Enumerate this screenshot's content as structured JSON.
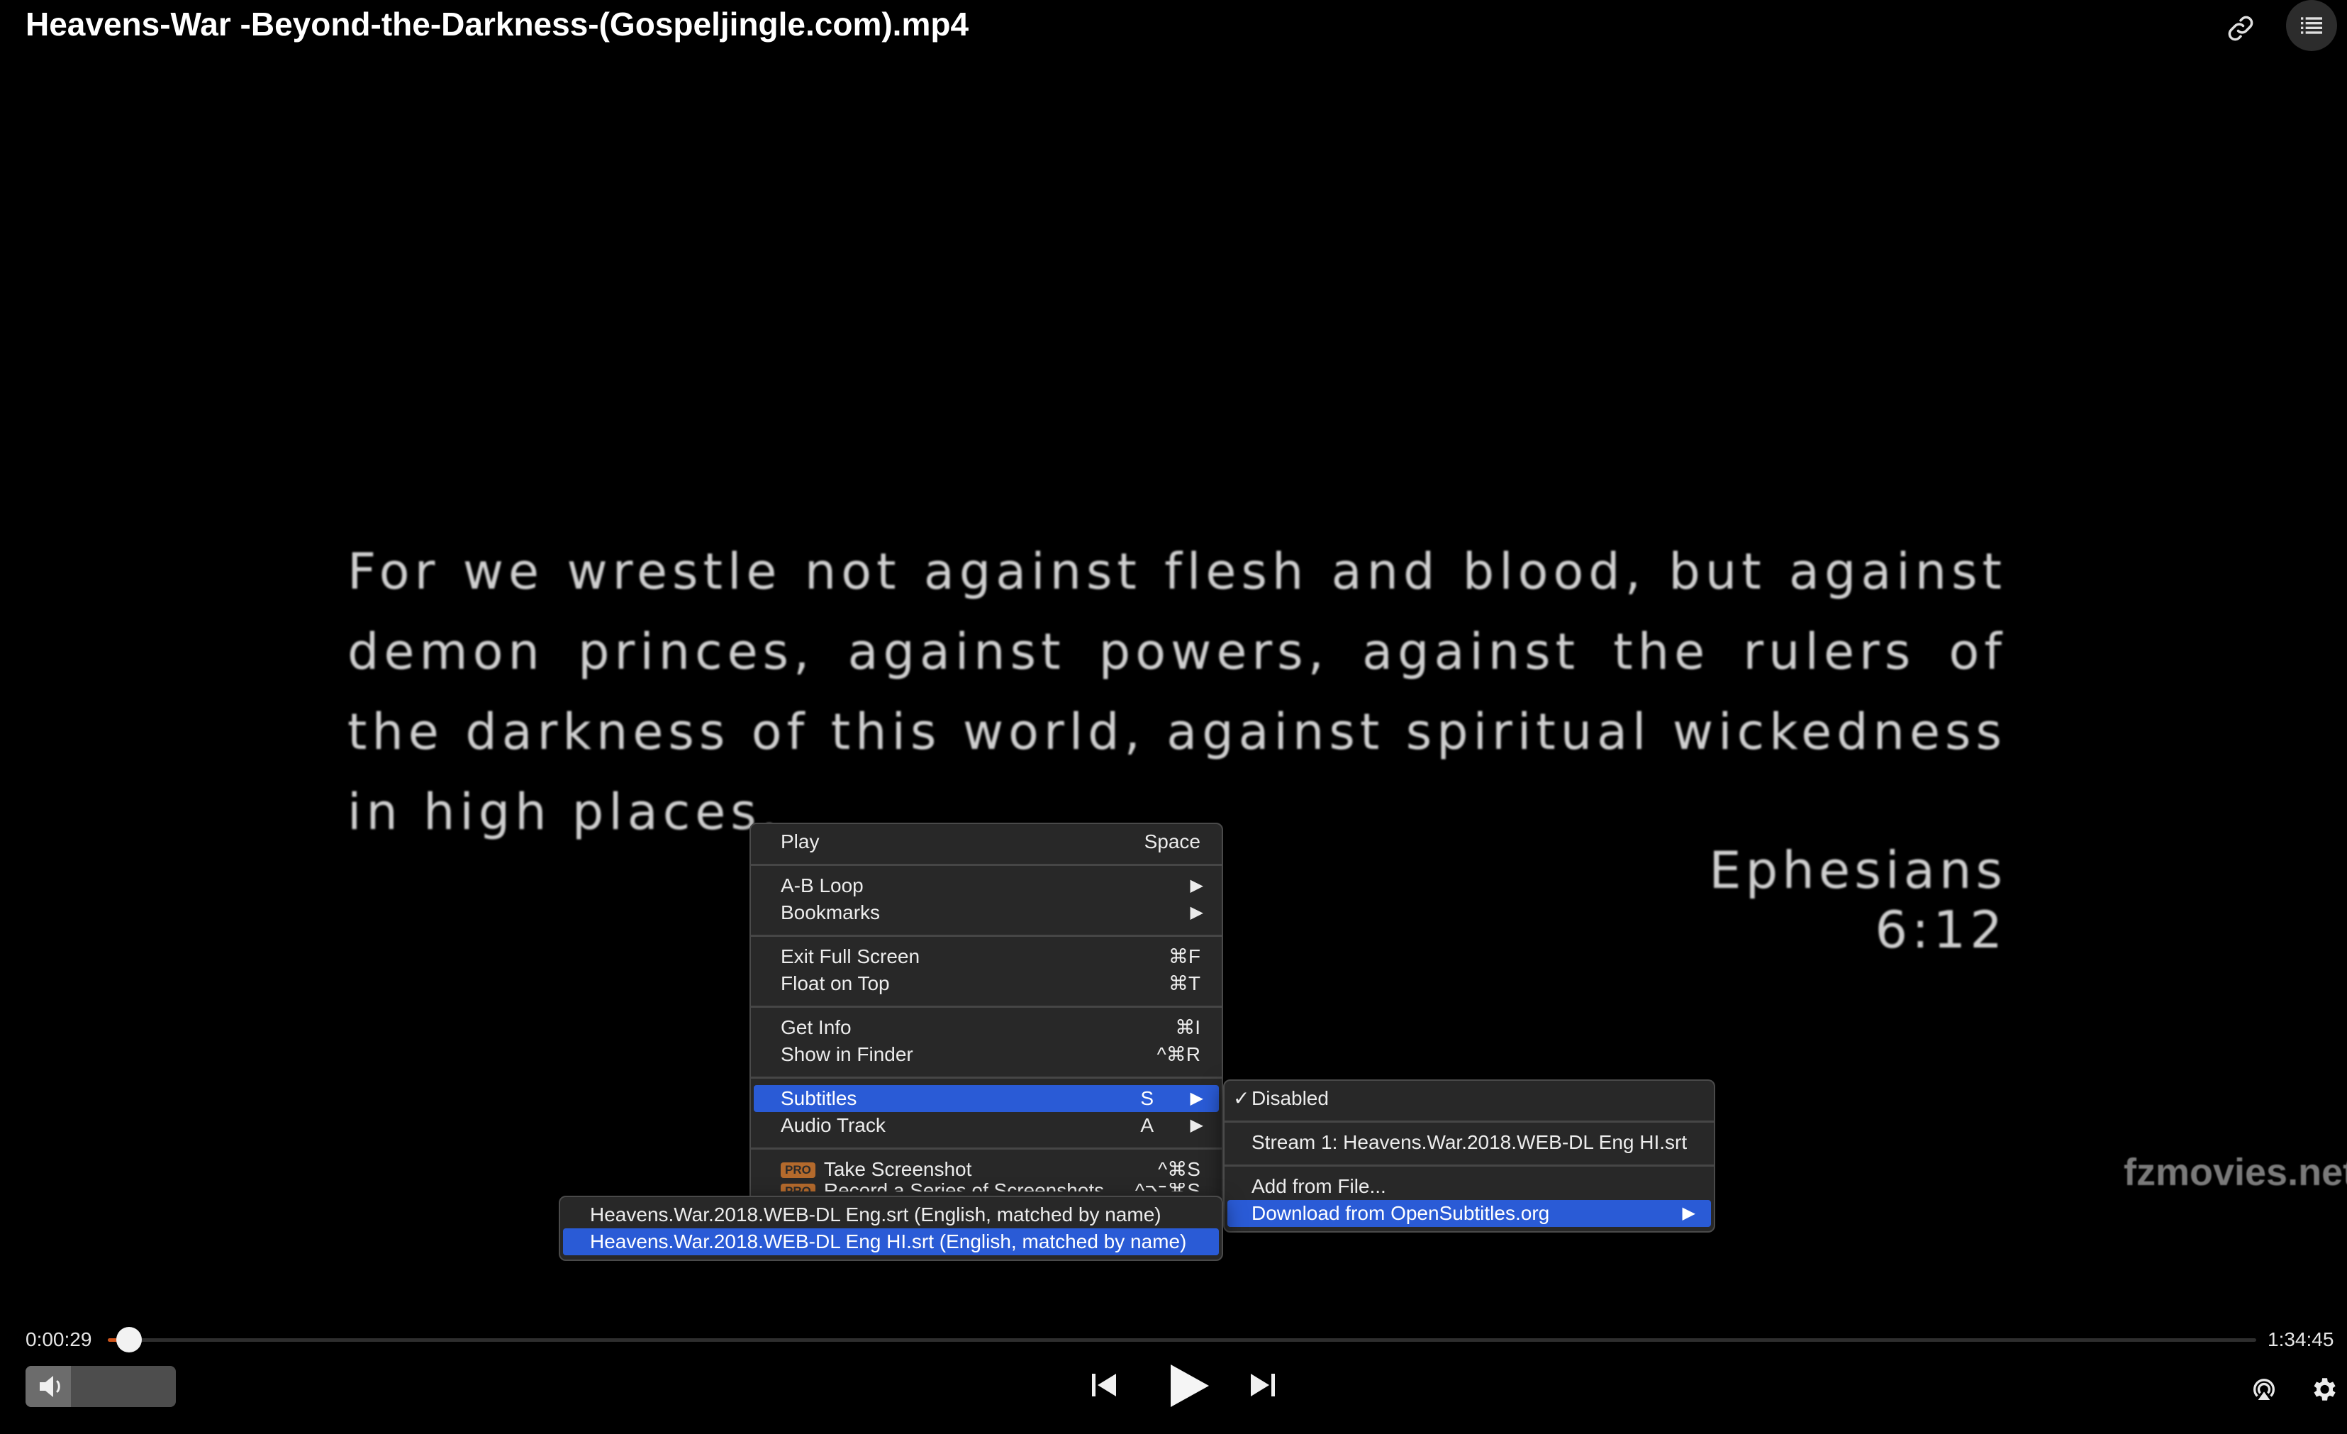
{
  "window": {
    "title": "Heavens-War -Beyond-the-Darkness-(Gospeljingle.com).mp4"
  },
  "video": {
    "verse_text": "For we wrestle not against flesh and blood, but against demon princes, against powers, against the rulers of the darkness of this world, against spiritual wickedness in high places.",
    "reference": "Ephesians 6:12",
    "watermark": "fzmovies.net"
  },
  "context_menu": {
    "play": {
      "label": "Play",
      "shortcut": "Space"
    },
    "ab_loop": {
      "label": "A-B Loop",
      "arrow": "▶"
    },
    "bookmarks": {
      "label": "Bookmarks",
      "arrow": "▶"
    },
    "exit_full_screen": {
      "label": "Exit Full Screen",
      "shortcut": "⌘F"
    },
    "float_on_top": {
      "label": "Float on Top",
      "shortcut": "⌘T"
    },
    "get_info": {
      "label": "Get Info",
      "shortcut": "⌘I"
    },
    "show_in_finder": {
      "label": "Show in Finder",
      "shortcut": "^⌘R"
    },
    "subtitles": {
      "label": "Subtitles",
      "key": "S",
      "arrow": "▶"
    },
    "audio_track": {
      "label": "Audio Track",
      "key": "A",
      "arrow": "▶"
    },
    "take_screenshot": {
      "badge": "PRO",
      "label": "Take Screenshot",
      "shortcut": "^⌘S"
    },
    "record_screenshots": {
      "badge": "PRO",
      "label": "Record a Series of Screenshots",
      "shortcut": "^⌥⌘S"
    }
  },
  "subtitles_menu": {
    "disabled": {
      "check": "✓",
      "label": "Disabled"
    },
    "stream1": {
      "label": "Stream 1: Heavens.War.2018.WEB-DL Eng HI.srt"
    },
    "add_from_file": {
      "label": "Add from File..."
    },
    "download": {
      "label": "Download from OpenSubtitles.org",
      "arrow": "▶"
    }
  },
  "download_menu": {
    "items": [
      "Heavens.War.2018.WEB-DL Eng.srt (English, matched by name)",
      "Heavens.War.2018.WEB-DL Eng HI.srt (English, matched by name)"
    ]
  },
  "controls": {
    "current_time": "0:00:29",
    "total_time": "1:34:45",
    "progress_fraction": 0.005,
    "volume_fraction": 0.3,
    "accent_color": "#d0561c",
    "highlight_color": "#2a5bd6",
    "icons": [
      "speaker-icon",
      "previous-icon",
      "play-icon",
      "next-icon",
      "airplay-icon",
      "gear-icon",
      "link-icon",
      "playlist-icon"
    ]
  }
}
